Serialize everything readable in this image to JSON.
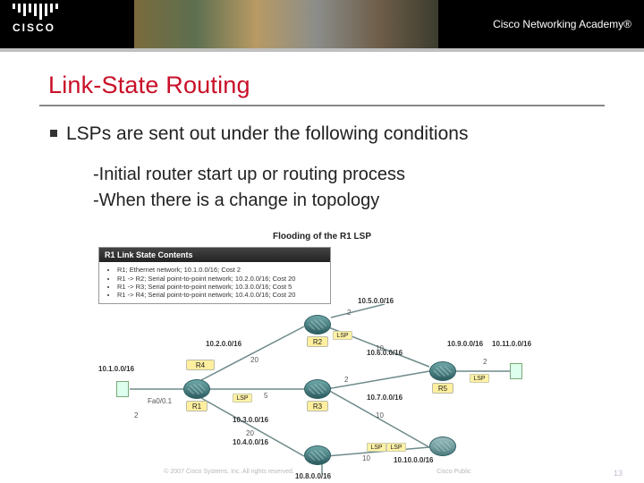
{
  "header": {
    "brand": "CISCO",
    "brand_sub": "cisco",
    "academy": "Cisco Networking Academy®"
  },
  "slide": {
    "title": "Link-State Routing",
    "bullet": "LSPs are sent out under the following conditions",
    "sub1": "-Initial router start up or routing process",
    "sub2": "-When there is a change in topology"
  },
  "diagram": {
    "title": "Flooding of the R1 LSP",
    "panel_header": "R1 Link State Contents",
    "panel_items": [
      "R1; Ethernet network; 10.1.0.0/16; Cost 2",
      "R1 -> R2; Serial point-to-point network; 10.2.0.0/16; Cost 20",
      "R1 -> R3; Serial point-to-point network; 10.3.0.0/16; Cost 5",
      "R1 -> R4; Serial point-to-point network; 10.4.0.0/16; Cost 20"
    ],
    "routers": {
      "r1": "R1",
      "r2": "R2",
      "r3": "R3",
      "r4": "R4",
      "r5": "R5"
    },
    "lsp_tag": "LSP",
    "iface": "Fa0/0.1",
    "networks": {
      "n1": "10.1.0.0/16",
      "n2": "10.2.0.0/16",
      "n3": "10.3.0.0/16",
      "n4": "10.4.0.0/16",
      "n5": "10.5.0.0/16",
      "n6": "10.6.0.0/16",
      "n7": "10.7.0.0/16",
      "n8": "10.8.0.0/16",
      "n9": "10.9.0.0/16",
      "n10": "10.10.0.0/16",
      "n11": "10.11.0.0/16"
    },
    "costs": {
      "c2a": "2",
      "c2b": "2",
      "c2c": "2",
      "c2d": "2",
      "c5": "5",
      "c10a": "10",
      "c10b": "10",
      "c10c": "10",
      "c20a": "20",
      "c20b": "20"
    }
  },
  "footer": {
    "copyright": "© 2007 Cisco Systems, Inc. All rights reserved.",
    "classification": "Cisco Public",
    "page": "13"
  }
}
